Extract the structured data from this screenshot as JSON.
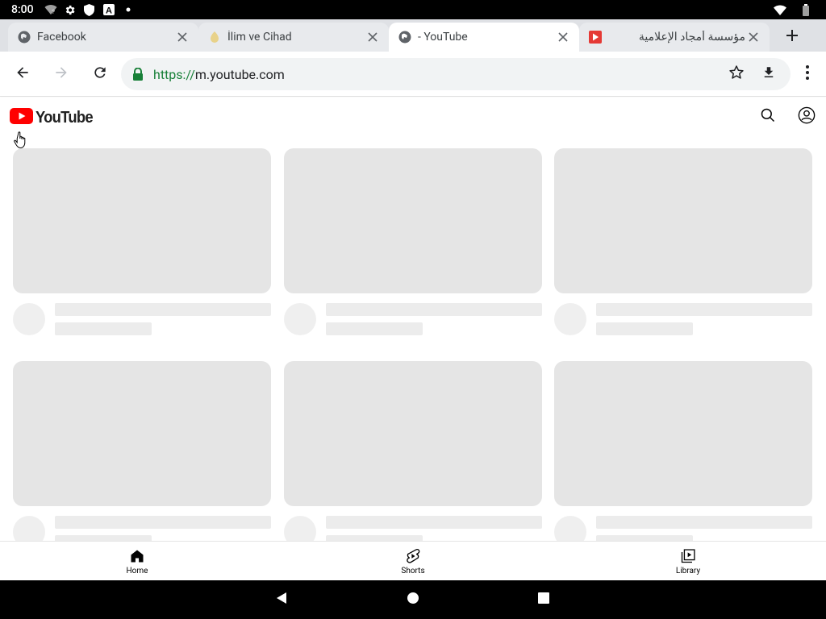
{
  "status_bar": {
    "time": "8:00",
    "left_icons": [
      "wifi-question-icon",
      "gear-icon",
      "shield-icon",
      "font-a-icon",
      "dot-icon"
    ],
    "right_icons": [
      "wifi-icon",
      "battery-icon"
    ]
  },
  "tabs": [
    {
      "title": "Facebook",
      "favicon": "globe-icon",
      "active": false
    },
    {
      "title": "İlim ve Cihad",
      "favicon": "yellow-favicon",
      "active": false
    },
    {
      "title": "- YouTube",
      "favicon": "globe-icon",
      "active": true
    },
    {
      "title": "مؤسسة أمجاد الإعلامية",
      "favicon": "red-play-icon",
      "active": false
    }
  ],
  "toolbar": {
    "url_scheme": "https://",
    "url_host": "m.youtube.com"
  },
  "youtube": {
    "logo_text": "YouTube"
  },
  "bottom_nav": {
    "items": [
      {
        "label": "Home",
        "icon": "home-icon"
      },
      {
        "label": "Shorts",
        "icon": "shorts-icon"
      },
      {
        "label": "Library",
        "icon": "library-icon"
      }
    ]
  },
  "colors": {
    "youtube_red": "#ff0000",
    "secure_green": "#188038",
    "skeleton": "#e5e5e5"
  }
}
